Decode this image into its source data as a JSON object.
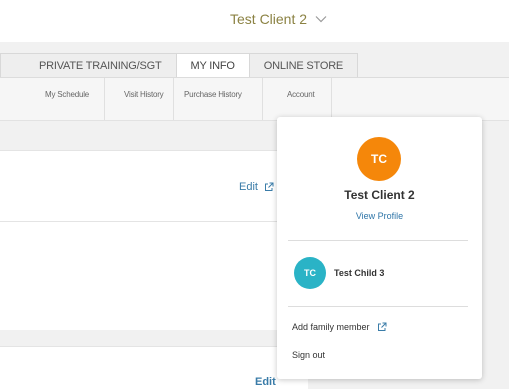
{
  "header": {
    "client_name": "Test Client 2",
    "chevron_icon": "chevron-down-icon"
  },
  "tabs": [
    {
      "label": "PRIVATE TRAINING/SGT",
      "active": false
    },
    {
      "label": "MY INFO",
      "active": true
    },
    {
      "label": "ONLINE STORE",
      "active": false
    }
  ],
  "subnav": [
    {
      "label": "My Schedule"
    },
    {
      "label": "Visit History"
    },
    {
      "label": "Purchase History"
    },
    {
      "label": "Account"
    }
  ],
  "content": {
    "edit_label_1": "Edit",
    "edit_label_2": "Edit"
  },
  "profile_menu": {
    "initials": "TC",
    "name": "Test Client 2",
    "view_profile_label": "View Profile",
    "family": [
      {
        "initials": "TC",
        "name": "Test Child 3"
      }
    ],
    "add_family_label": "Add family member",
    "sign_out_label": "Sign out"
  },
  "colors": {
    "client_name": "#8b8243",
    "link": "#2e75a8",
    "avatar_client": "#f5870a",
    "avatar_child": "#2ab3c6"
  }
}
